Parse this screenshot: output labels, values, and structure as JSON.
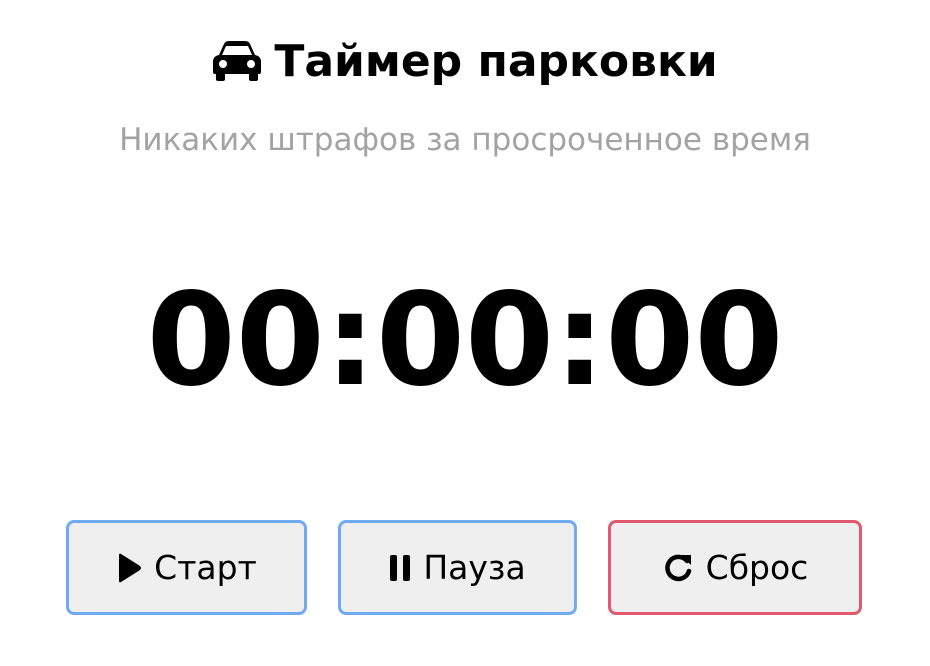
{
  "header": {
    "icon": "car-icon",
    "title": "Таймер парковки",
    "subtitle": "Никаких штрафов за просроченное время"
  },
  "timer": {
    "display": "00:00:00"
  },
  "controls": {
    "start": {
      "label": "Старт",
      "icon": "play-icon",
      "border_color": "#71aaf0"
    },
    "pause": {
      "label": "Пауза",
      "icon": "pause-icon",
      "border_color": "#71aaf0"
    },
    "reset": {
      "label": "Сброс",
      "icon": "redo-icon",
      "border_color": "#e0596f"
    }
  }
}
